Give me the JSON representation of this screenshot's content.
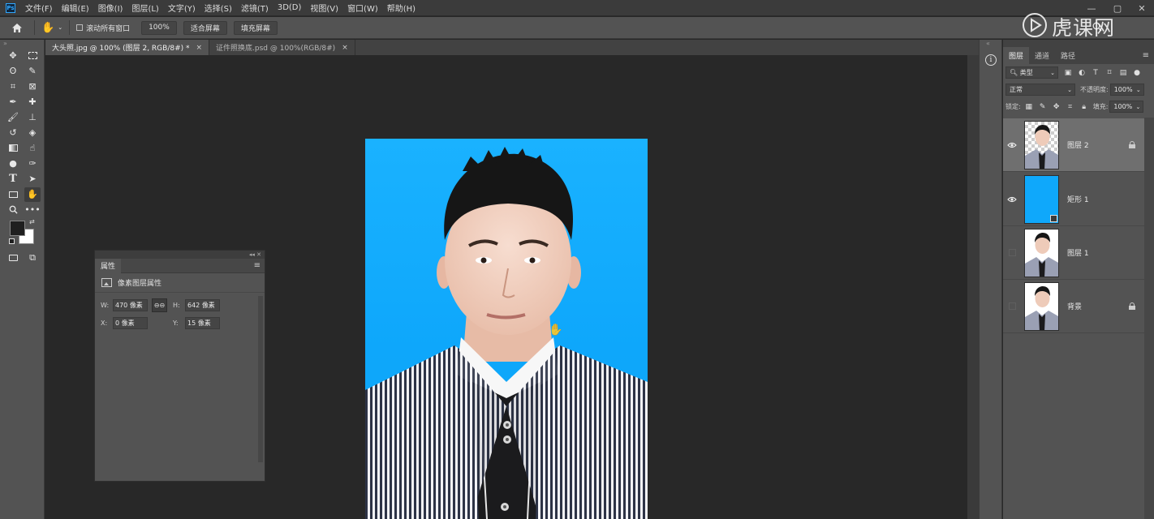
{
  "app": {
    "logo": "Ps"
  },
  "menu": [
    "文件(F)",
    "编辑(E)",
    "图像(I)",
    "图层(L)",
    "文字(Y)",
    "选择(S)",
    "滤镜(T)",
    "3D(D)",
    "视图(V)",
    "窗口(W)",
    "帮助(H)"
  ],
  "watermark": "虎课网",
  "options_bar": {
    "scroll_all_windows": "滚动所有窗口",
    "zoom": "100%",
    "fit_screen": "适合屏幕",
    "fill_screen": "填充屏幕"
  },
  "tabs": [
    {
      "label": "大头照.jpg @ 100% (图层 2, RGB/8#) *",
      "active": true
    },
    {
      "label": "证件照换底.psd @ 100%(RGB/8#)",
      "active": false
    }
  ],
  "tab_close": "×",
  "properties": {
    "tab": "属性",
    "subtitle": "像素图层属性",
    "w_label": "W:",
    "w_value": "470 像素",
    "h_label": "H:",
    "h_value": "642 像素",
    "x_label": "X:",
    "x_value": "0 像素",
    "y_label": "Y:",
    "y_value": "15 像素"
  },
  "layers_panel": {
    "tabs": [
      "图层",
      "通道",
      "路径"
    ],
    "filter_kind": "类型",
    "blend_mode": "正常",
    "opacity_label": "不透明度:",
    "opacity_value": "100%",
    "lock_label": "锁定:",
    "fill_label": "填充:",
    "fill_value": "100%",
    "layers": [
      {
        "name": "图层 2",
        "visible": true,
        "selected": true,
        "locked": true
      },
      {
        "name": "矩形 1",
        "visible": true,
        "selected": false,
        "locked": false
      },
      {
        "name": "图层 1",
        "visible": false,
        "selected": false,
        "locked": false
      },
      {
        "name": "背景",
        "visible": false,
        "selected": false,
        "locked": true
      }
    ]
  },
  "colors": {
    "foreground": "#1f1f1f",
    "background": "#ffffff",
    "photo_bg": "#0fa8fb",
    "accent": "#31a8ff"
  },
  "icons": [
    "home-icon",
    "hand-icon",
    "move-icon",
    "marquee-icon",
    "lasso-icon",
    "quick-select-icon",
    "crop-icon",
    "frame-icon",
    "eyedropper-icon",
    "healing-icon",
    "brush-icon",
    "stamp-icon",
    "history-brush-icon",
    "eraser-icon",
    "gradient-icon",
    "smudge-icon",
    "dodge-icon",
    "pen-icon",
    "type-icon",
    "path-select-icon",
    "rectangle-icon",
    "zoom-icon",
    "more-icon",
    "info-icon",
    "eye-icon",
    "lock-icon"
  ]
}
